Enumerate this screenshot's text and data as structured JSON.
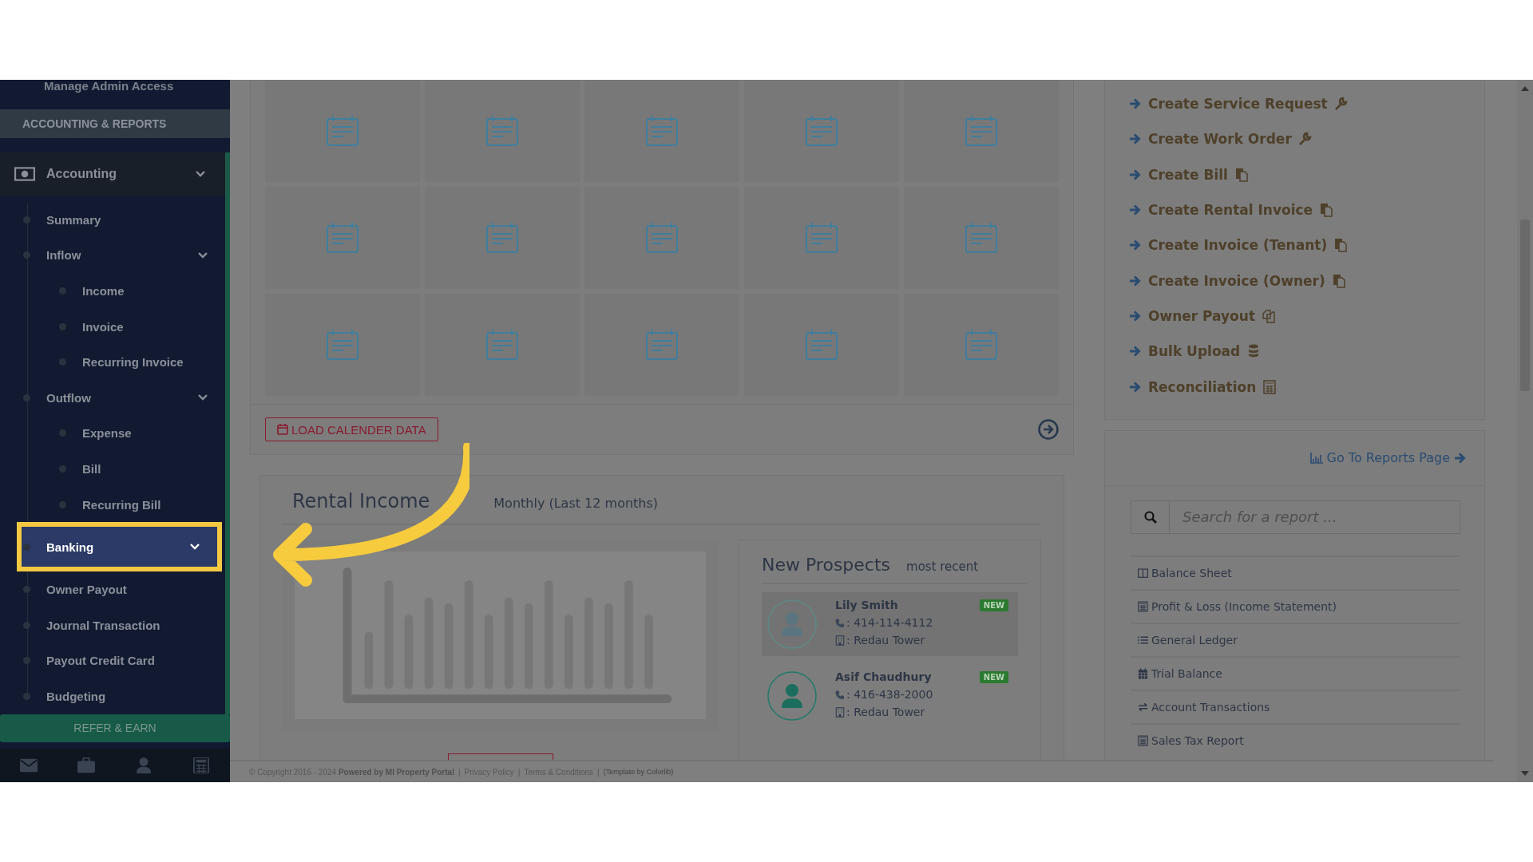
{
  "sidebar": {
    "top_link": "Manage Admin Access",
    "section_title": "ACCOUNTING & REPORTS",
    "group": {
      "label": "Accounting",
      "expanded": true
    },
    "items": [
      {
        "label": "Summary",
        "selected": false,
        "kind": "link"
      },
      {
        "label": "Inflow",
        "selected": false,
        "kind": "group",
        "children": [
          {
            "label": "Income",
            "selected": false
          },
          {
            "label": "Invoice",
            "selected": false
          },
          {
            "label": "Recurring Invoice",
            "selected": false
          }
        ]
      },
      {
        "label": "Outflow",
        "selected": false,
        "kind": "group",
        "children": [
          {
            "label": "Expense",
            "selected": false
          },
          {
            "label": "Bill",
            "selected": false
          },
          {
            "label": "Recurring Bill",
            "selected": false
          }
        ]
      },
      {
        "label": "Banking",
        "selected": true,
        "kind": "group"
      },
      {
        "label": "Owner Payout",
        "selected": false,
        "kind": "link"
      },
      {
        "label": "Journal Transaction",
        "selected": false,
        "kind": "link"
      },
      {
        "label": "Payout Credit Card",
        "selected": false,
        "kind": "link"
      },
      {
        "label": "Budgeting",
        "selected": false,
        "kind": "link"
      }
    ],
    "refer_button": "REFER & EARN"
  },
  "calendar": {
    "load_button": "LOAD CALENDER DATA"
  },
  "rental_income": {
    "title": "Rental Income",
    "subtitle": "Monthly (Last 12 months)"
  },
  "new_prospects": {
    "title": "New Prospects",
    "subtitle": "most recent",
    "items": [
      {
        "name": "Lily Smith",
        "badge": "NEW",
        "phone": ": 414-114-4112",
        "property": ": Redau Tower",
        "selected": true
      },
      {
        "name": "Asif Chaudhury",
        "badge": "NEW",
        "phone": ": 416-438-2000",
        "property": ": Redau Tower",
        "selected": false
      }
    ]
  },
  "quick_actions": [
    "Create Service Request",
    "Create Work Order",
    "Create Bill",
    "Create Rental Invoice",
    "Create Invoice (Tenant)",
    "Create Invoice (Owner)",
    "Owner Payout",
    "Bulk Upload",
    "Reconciliation"
  ],
  "reports": {
    "link": "Go To Reports Page",
    "search": {
      "placeholder": "Search for a report ..."
    },
    "items": [
      "Balance Sheet",
      "Profit & Loss (Income Statement)",
      "General Ledger",
      "Trial Balance",
      "Account Transactions",
      "Sales Tax Report"
    ]
  },
  "footer": {
    "separator": "|",
    "copyright": "© Copyright 2016 - 2024 **Powered by MI Property Portal**",
    "links": [
      "Privacy Policy",
      "Terms & Conditions"
    ],
    "credit": "(Template by Colorlib)"
  }
}
